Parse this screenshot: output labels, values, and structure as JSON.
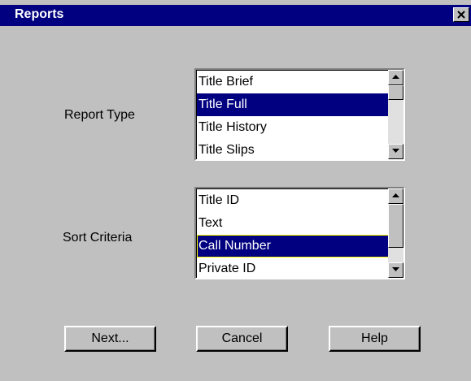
{
  "window": {
    "title": "Reports",
    "close_glyph": "✕"
  },
  "report_type": {
    "label": "Report Type",
    "items": [
      "Title Brief",
      "Title Full",
      "Title History",
      "Title Slips"
    ],
    "selected_index": 1
  },
  "sort_criteria": {
    "label": "Sort Criteria",
    "items": [
      "Title ID",
      "Text",
      "Call Number",
      "Private ID"
    ],
    "selected_index": 2
  },
  "buttons": {
    "next": "Next...",
    "cancel": "Cancel",
    "help": "Help"
  },
  "colors": {
    "title_bar": "#000080",
    "selection": "#000080",
    "dialog_bg": "#c0c0c0"
  },
  "icons": {
    "close": "close-icon",
    "scroll_up": "arrow-up-icon",
    "scroll_down": "arrow-down-icon"
  }
}
